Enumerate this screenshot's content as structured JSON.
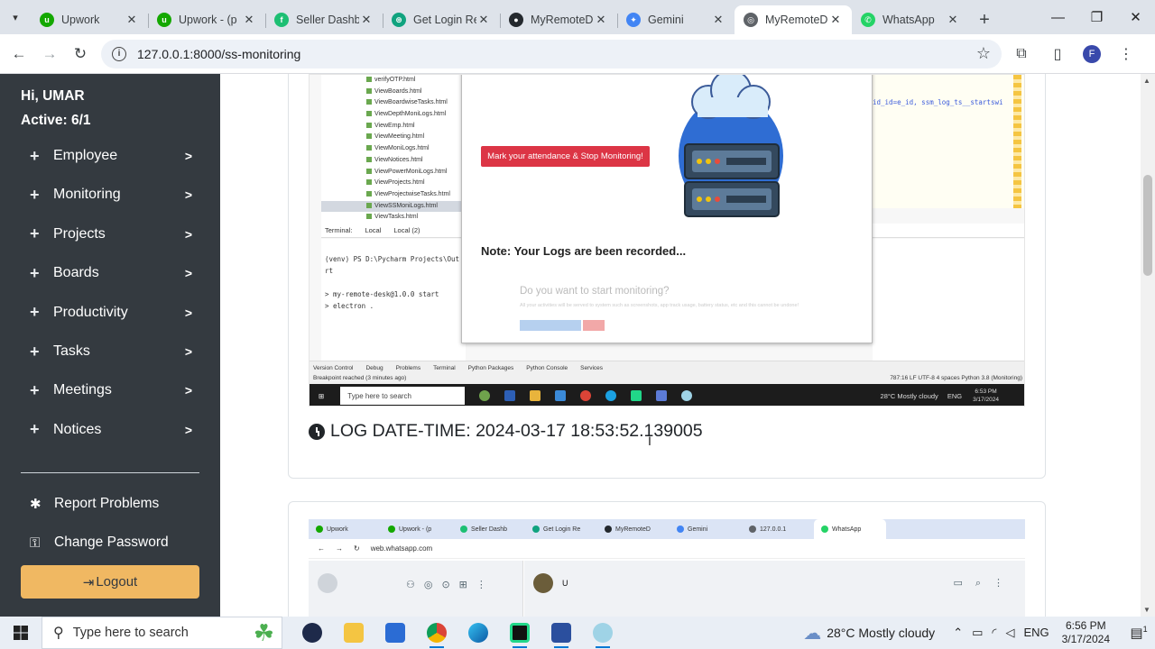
{
  "browser": {
    "tabs": [
      {
        "title": "Upwork",
        "favicon_color": "#14a800",
        "glyph": "u"
      },
      {
        "title": "Upwork - (p",
        "favicon_color": "#14a800",
        "glyph": "u"
      },
      {
        "title": "Seller Dashb",
        "favicon_color": "#1dbf73",
        "glyph": "f"
      },
      {
        "title": "Get Login Re",
        "favicon_color": "#10a37f",
        "glyph": "⊛"
      },
      {
        "title": "MyRemoteD",
        "favicon_color": "#24292e",
        "glyph": "●"
      },
      {
        "title": "Gemini",
        "favicon_color": "#4285f4",
        "glyph": "✦"
      },
      {
        "title": "MyRemoteD",
        "favicon_color": "#5f6368",
        "glyph": "◎"
      },
      {
        "title": "WhatsApp",
        "favicon_color": "#25d366",
        "glyph": "✆"
      }
    ],
    "active_tab_index": 6,
    "url": "127.0.0.1:8000/ss-monitoring",
    "profile_letter": "F"
  },
  "sidebar": {
    "greeting": "Hi, UMAR",
    "active": "Active: 6/1",
    "items": [
      {
        "label": "Employee"
      },
      {
        "label": "Monitoring"
      },
      {
        "label": "Projects"
      },
      {
        "label": "Boards"
      },
      {
        "label": "Productivity"
      },
      {
        "label": "Tasks"
      },
      {
        "label": "Meetings"
      },
      {
        "label": "Notices"
      }
    ],
    "report_problems": "Report Problems",
    "change_password": "Change Password",
    "logout": "Logout"
  },
  "log1": {
    "label": "LOG DATE-TIME: 2024-03-17 18:53:52.139005",
    "screenshot": {
      "files": [
        "verifyOTP.html",
        "ViewBoards.html",
        "ViewBoardwiseTasks.html",
        "ViewDepthMoniLogs.html",
        "ViewEmp.html",
        "ViewMeeting.html",
        "ViewMoniLogs.html",
        "ViewNotices.html",
        "ViewPowerMoniLogs.html",
        "ViewProjects.html",
        "ViewProjectwiseTasks.html",
        "ViewSSMoniLogs.html",
        "ViewTasks.html"
      ],
      "selected_file": "ViewSSMoniLogs.html",
      "code_snippet": "id_id=e_id, ssm_log_ts__startswi",
      "terminal_tabs": [
        "Terminal:",
        "Local",
        "Local (2)"
      ],
      "terminal_lines": [
        "(venv) PS D:\\Pycharm Projects\\Out",
        "rt",
        "",
        "> my-remote-desk@1.0.0 start",
        "> electron ."
      ],
      "dialog_button": "Mark your attendance & Stop Monitoring!",
      "dialog_note": "Note: Your Logs are been recorded...",
      "dialog_question": "Do you want to start monitoring?",
      "dialog_small": "All your activities will be served to system such as screenshots, app track usage, battery status, etc and this cannot be undone!",
      "ide_tools": [
        "Version Control",
        "Debug",
        "Problems",
        "Terminal",
        "Python Packages",
        "Python Console",
        "Services"
      ],
      "ide_status_left": "Breakpoint reached (3 minutes ago)",
      "ide_status_right": "787:16   LF   UTF-8   4 spaces   Python 3.8 (Monitoring)",
      "taskbar_search": "Type here to search",
      "taskbar_weather": "28°C  Mostly cloudy",
      "taskbar_lang": "ENG",
      "taskbar_time": "6:53 PM",
      "taskbar_date": "3/17/2024"
    }
  },
  "log2": {
    "screenshot": {
      "tabs": [
        "Upwork",
        "Upwork - (p",
        "Seller Dashb",
        "Get Login Re",
        "MyRemoteD",
        "Gemini",
        "127.0.0.1",
        "WhatsApp"
      ],
      "url": "web.whatsapp.com",
      "contact_initial": "U"
    }
  },
  "taskbar": {
    "search_placeholder": "Type here to search",
    "weather": "28°C  Mostly cloudy",
    "language": "ENG",
    "time": "6:56 PM",
    "date": "3/17/2024",
    "notification_count": "1"
  }
}
